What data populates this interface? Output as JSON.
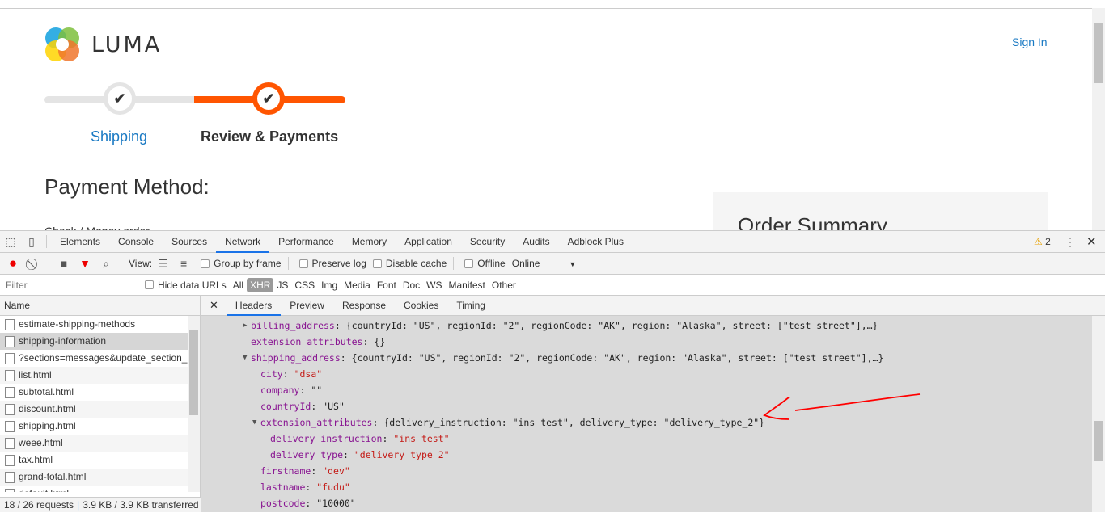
{
  "page": {
    "brand": "LUMA",
    "sign_in": "Sign In",
    "steps": [
      {
        "label": "Shipping",
        "icon": "check-icon"
      },
      {
        "label": "Review & Payments",
        "icon": "check-icon"
      }
    ],
    "payment_method_title": "Payment Method:",
    "payment_option": "Check / Money order",
    "order_summary": "Order Summary",
    "accent": "#ff5501",
    "link_color": "#1979c3"
  },
  "devtools": {
    "tabs": [
      "Elements",
      "Console",
      "Sources",
      "Network",
      "Performance",
      "Memory",
      "Application",
      "Security",
      "Audits",
      "Adblock Plus"
    ],
    "active_tab": "Network",
    "warnings": "2",
    "toolbar": {
      "view_label": "View:",
      "group_by_frame": "Group by frame",
      "preserve_log": "Preserve log",
      "disable_cache": "Disable cache",
      "offline": "Offline",
      "throttle": "Online"
    },
    "filter": {
      "placeholder": "Filter",
      "hide_data_urls": "Hide data URLs",
      "types": [
        "All",
        "XHR",
        "JS",
        "CSS",
        "Img",
        "Media",
        "Font",
        "Doc",
        "WS",
        "Manifest",
        "Other"
      ],
      "active_type": "XHR"
    },
    "name_header": "Name",
    "requests": [
      "estimate-shipping-methods",
      "shipping-information",
      "?sections=messages&update_section_i...",
      "list.html",
      "subtotal.html",
      "discount.html",
      "shipping.html",
      "weee.html",
      "tax.html",
      "grand-total.html",
      "default.html"
    ],
    "selected_request": "shipping-information",
    "status": {
      "requests": "18 / 26 requests",
      "transferred": "3.9 KB / 3.9 KB transferred"
    },
    "detail_tabs": [
      "Headers",
      "Preview",
      "Response",
      "Cookies",
      "Timing"
    ],
    "active_detail_tab": "Headers",
    "payload": [
      {
        "key": "billing_address",
        "value": "{countryId: \"US\", regionId: \"2\", regionCode: \"AK\", region: \"Alaska\", street: [\"test street\"],…}",
        "indent": 0,
        "toggle": "collapsed",
        "type": "object"
      },
      {
        "key": "extension_attributes",
        "value": "{}",
        "indent": 0,
        "type": "object"
      },
      {
        "key": "shipping_address",
        "value": "{countryId: \"US\", regionId: \"2\", regionCode: \"AK\", region: \"Alaska\", street: [\"test street\"],…}",
        "indent": 0,
        "toggle": "expanded",
        "type": "object"
      },
      {
        "key": "city",
        "value": "\"dsa\"",
        "indent": 1,
        "type": "string"
      },
      {
        "key": "company",
        "value": "\"\"",
        "indent": 1,
        "type": "plain"
      },
      {
        "key": "countryId",
        "value": "\"US\"",
        "indent": 1,
        "type": "plain"
      },
      {
        "key": "extension_attributes",
        "value": "{delivery_instruction: \"ins test\", delivery_type: \"delivery_type_2\"}",
        "indent": 1,
        "toggle": "expanded",
        "type": "object"
      },
      {
        "key": "delivery_instruction",
        "value": "\"ins test\"",
        "indent": 2,
        "type": "string"
      },
      {
        "key": "delivery_type",
        "value": "\"delivery_type_2\"",
        "indent": 2,
        "type": "string"
      },
      {
        "key": "firstname",
        "value": "\"dev\"",
        "indent": 1,
        "type": "string"
      },
      {
        "key": "lastname",
        "value": "\"fudu\"",
        "indent": 1,
        "type": "string"
      },
      {
        "key": "postcode",
        "value": "\"10000\"",
        "indent": 1,
        "type": "plain"
      }
    ],
    "annotation_color": "#ff0000"
  }
}
